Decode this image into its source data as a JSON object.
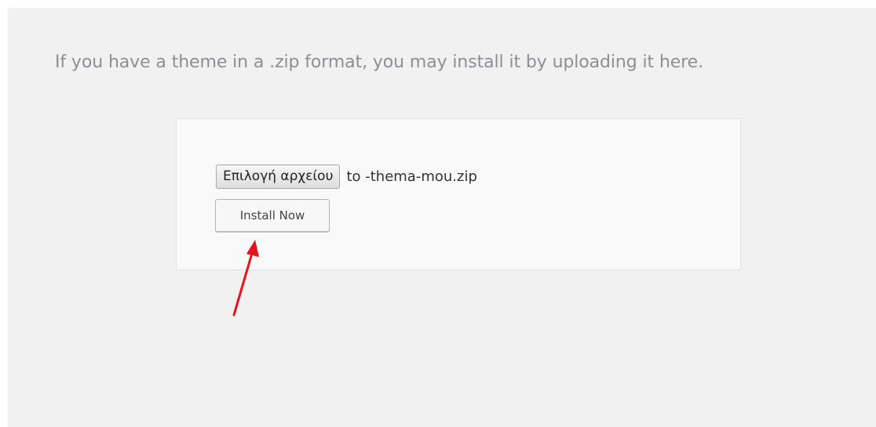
{
  "intro_text": "If you have a theme in a .zip format, you may install it by uploading it here.",
  "upload_form": {
    "choose_file_label": "Επιλογή αρχείου",
    "selected_file_name": "to -thema-mou.zip",
    "install_button_label": "Install Now"
  },
  "annotation": {
    "icon": "red-arrow-icon",
    "color": "#e8141b"
  }
}
